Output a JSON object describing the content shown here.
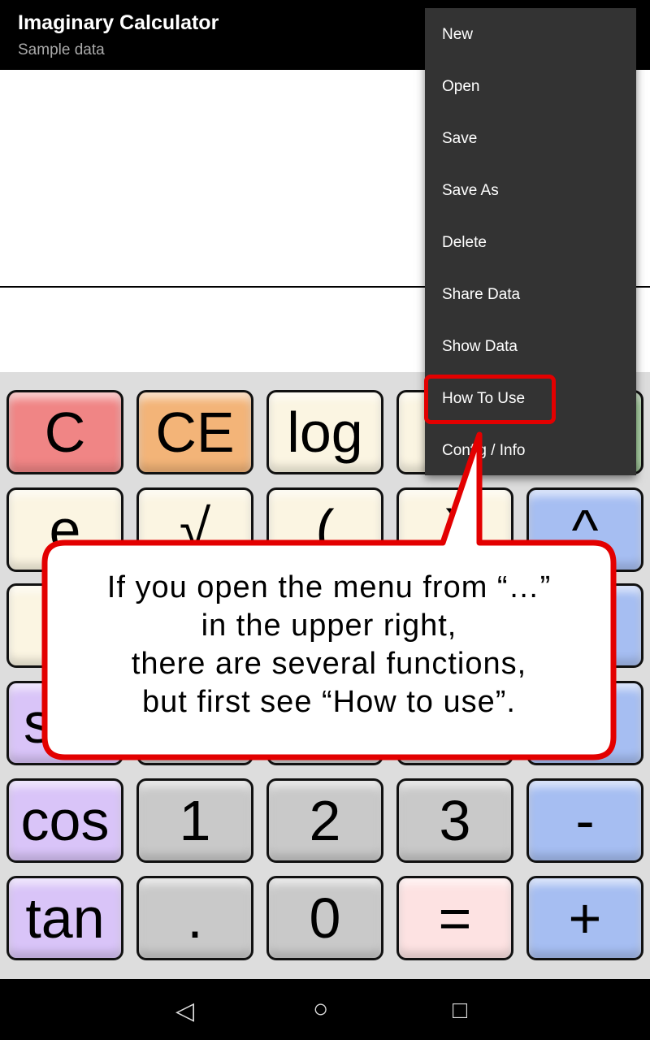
{
  "app": {
    "title": "Imaginary Calculator",
    "subtitle": "Sample data"
  },
  "keys": [
    {
      "label": "C",
      "color": "#f08585"
    },
    {
      "label": "CE",
      "color": "#f3b478"
    },
    {
      "label": "log",
      "color": "#fbf5e2"
    },
    {
      "label": "e"
    },
    {
      "label": "√"
    },
    {
      "label": "("
    },
    {
      "label": ")"
    },
    {
      "label": "^"
    },
    {
      "label": "s"
    },
    {
      "label": "cos"
    },
    {
      "label": "1"
    },
    {
      "label": "2"
    },
    {
      "label": "3"
    },
    {
      "label": "-"
    },
    {
      "label": "tan"
    },
    {
      "label": "."
    },
    {
      "label": "0"
    },
    {
      "label": "="
    },
    {
      "label": "+"
    }
  ],
  "menu": {
    "items": [
      "New",
      "Open",
      "Save",
      "Save As",
      "Delete",
      "Share Data",
      "Show Data",
      "How To Use",
      "Config / Info"
    ],
    "highlighted": "How To Use",
    "highlight_color": "#e30000"
  },
  "callout": {
    "lines": [
      "If you open the menu from “…”",
      "in the upper right,",
      "there are several functions,",
      "but first see “How to use”."
    ]
  },
  "nav": {
    "back": "◁",
    "home": "○",
    "recents": "□"
  }
}
